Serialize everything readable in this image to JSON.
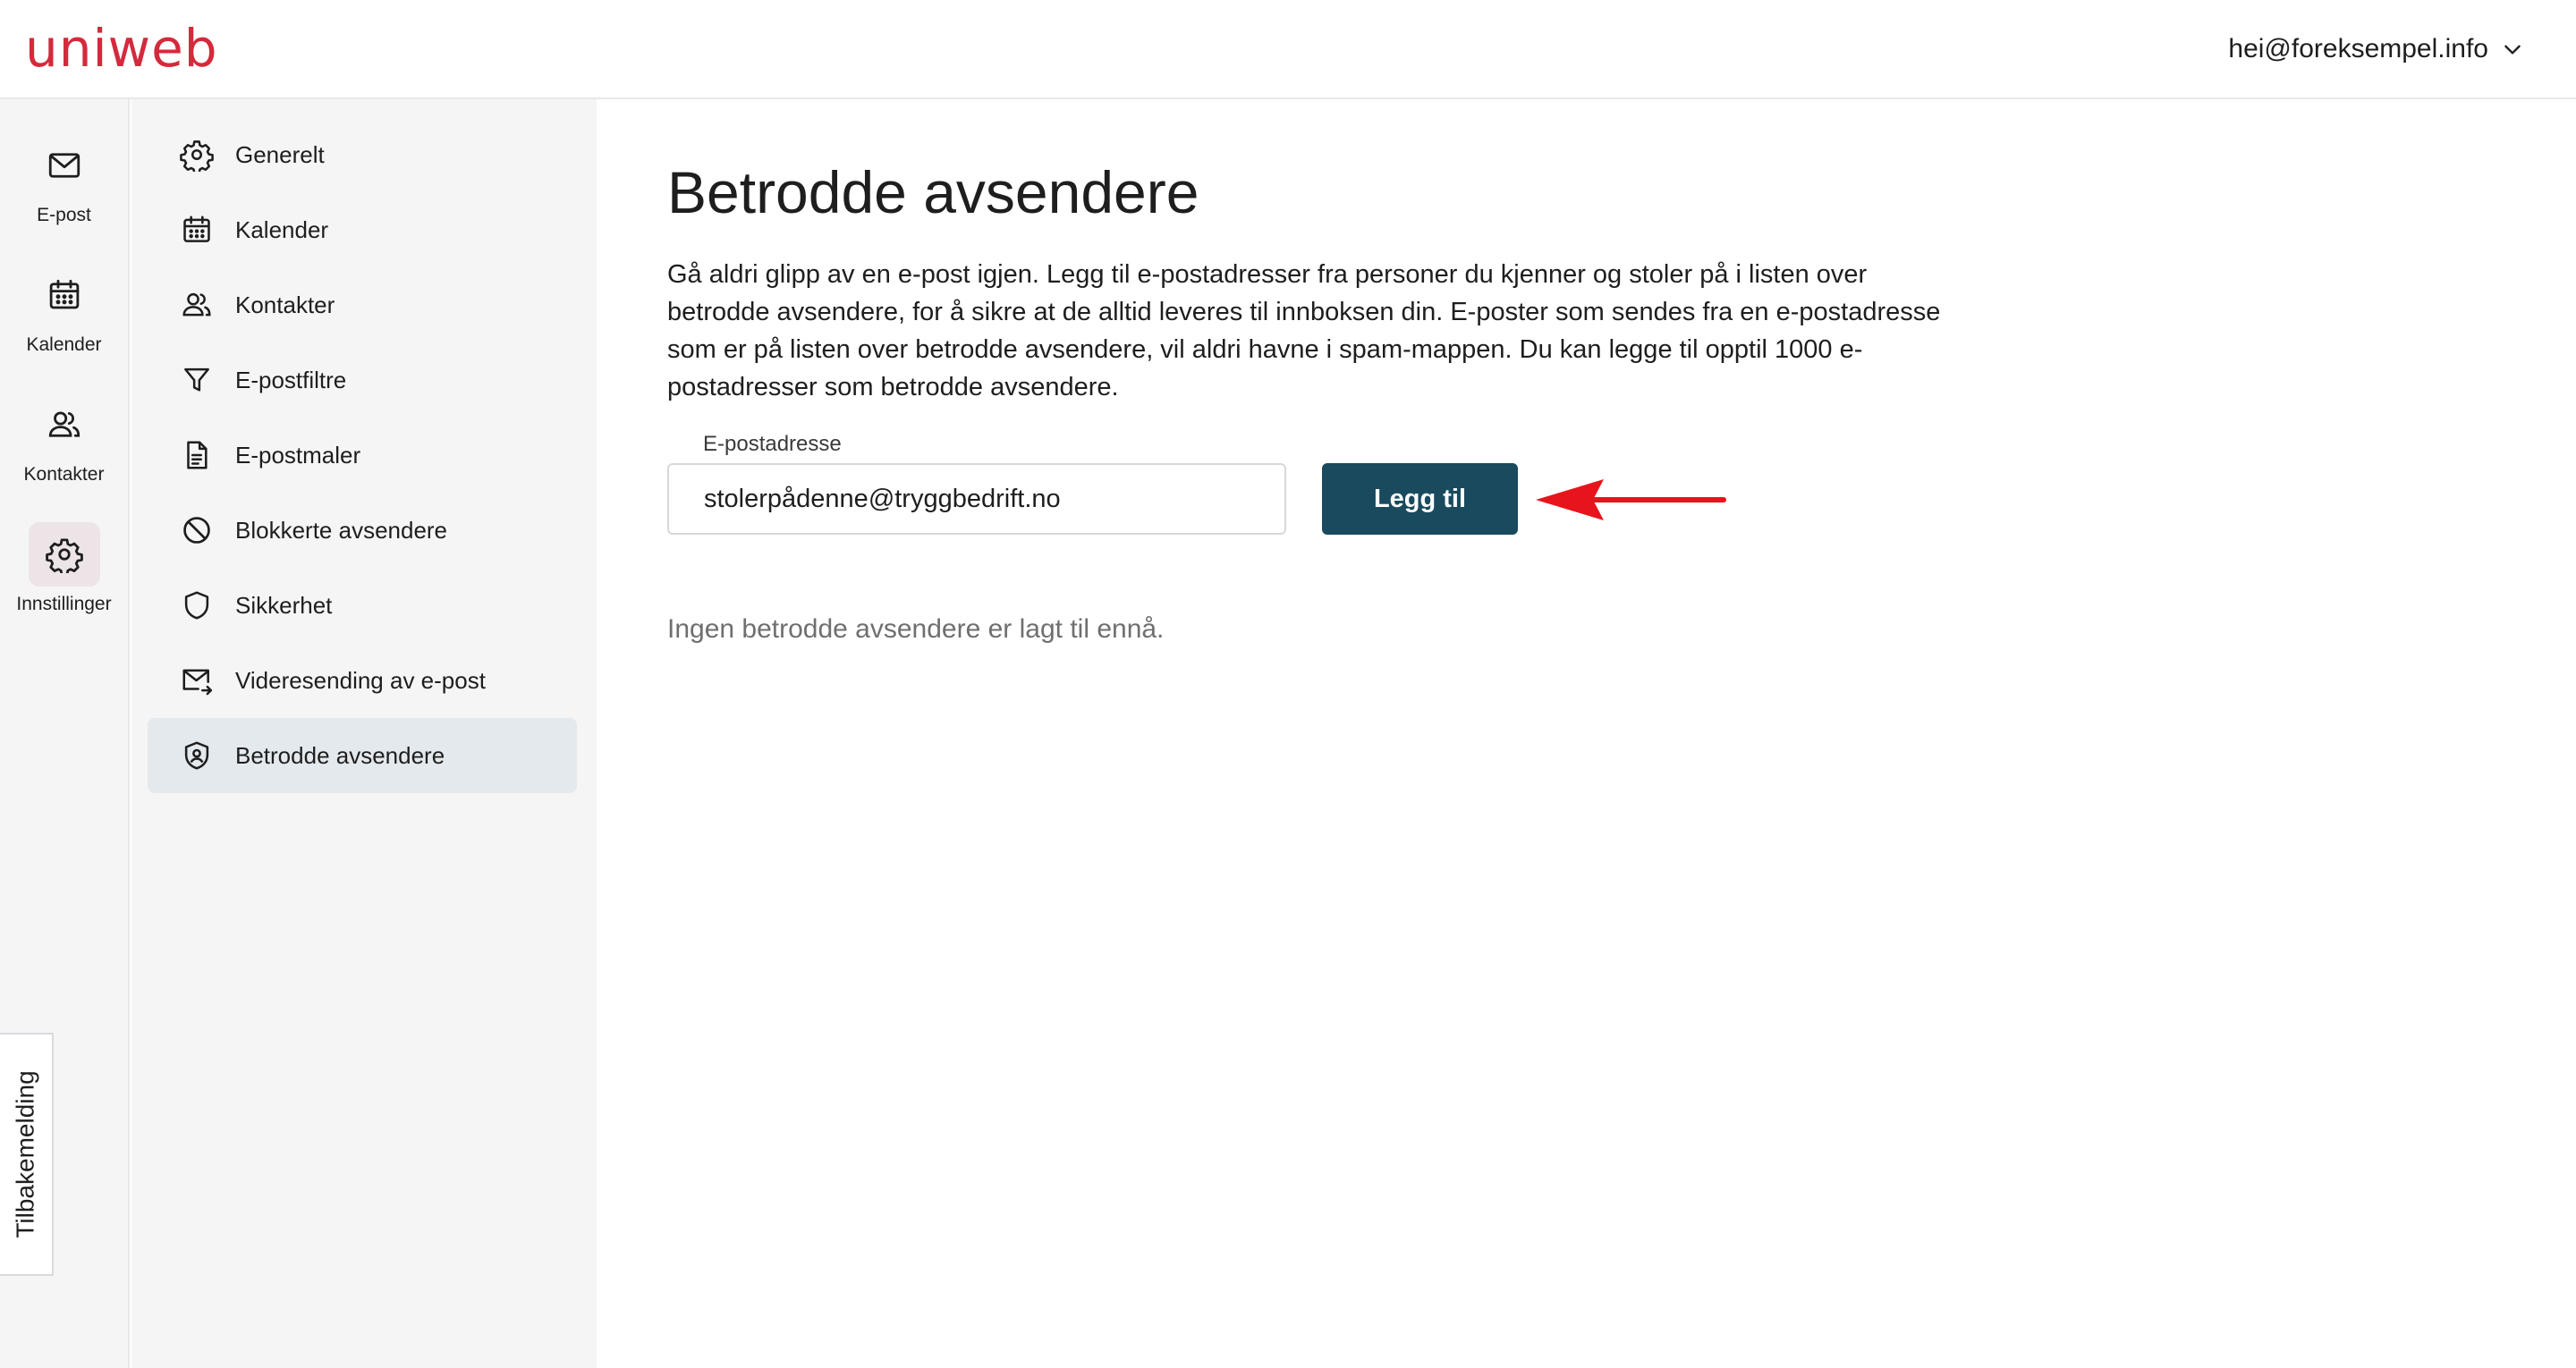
{
  "brand": {
    "logo_text": "uniweb",
    "accent_color": "#d42a3c"
  },
  "header": {
    "user_email": "hei@foreksempel.info"
  },
  "rail": {
    "items": [
      {
        "label": "E-post",
        "icon": "mail-icon"
      },
      {
        "label": "Kalender",
        "icon": "calendar-icon"
      },
      {
        "label": "Kontakter",
        "icon": "contacts-icon"
      },
      {
        "label": "Innstillinger",
        "icon": "gear-icon",
        "active": true
      }
    ],
    "feedback_label": "Tilbakemelding"
  },
  "settings_nav": {
    "items": [
      {
        "label": "Generelt",
        "icon": "gear-icon"
      },
      {
        "label": "Kalender",
        "icon": "calendar-icon"
      },
      {
        "label": "Kontakter",
        "icon": "contacts-icon"
      },
      {
        "label": "E-postfiltre",
        "icon": "filter-icon"
      },
      {
        "label": "E-postmaler",
        "icon": "document-icon"
      },
      {
        "label": "Blokkerte avsendere",
        "icon": "block-icon"
      },
      {
        "label": "Sikkerhet",
        "icon": "shield-icon"
      },
      {
        "label": "Videresending av e-post",
        "icon": "mail-forward-icon"
      },
      {
        "label": "Betrodde avsendere",
        "icon": "shield-user-icon",
        "active": true
      }
    ]
  },
  "main": {
    "title": "Betrodde avsendere",
    "description": "Gå aldri glipp av en e-post igjen. Legg til e-postadresser fra personer du kjenner og stoler på i listen over betrodde avsendere, for å sikre at de alltid leveres til innboksen din. E-poster som sendes fra en e-postadresse som er på listen over betrodde avsendere, vil aldri havne i spam-mappen. Du kan legge til opptil 1000 e-postadresser som betrodde avsendere.",
    "email_label": "E-postadresse",
    "email_value": "stolerpådenne@tryggbedrift.no",
    "add_button": "Legg til",
    "empty_state": "Ingen betrodde avsendere er lagt til ennå.",
    "button_color": "#194a5e",
    "annotation_arrow_color": "#e8141c"
  }
}
